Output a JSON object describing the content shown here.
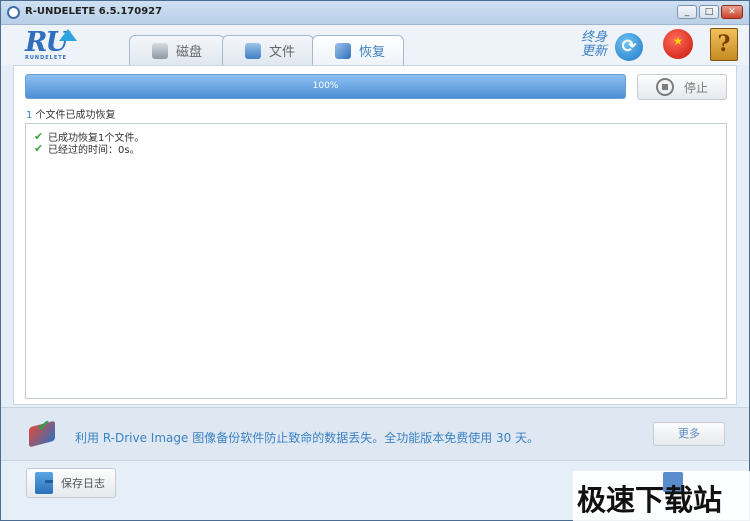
{
  "window": {
    "title": "R-UNDELETE 6.5.170927",
    "controls": [
      "_",
      "□",
      "✕"
    ]
  },
  "logo": {
    "letters": "RU",
    "subtitle": "RUNDELETE"
  },
  "tabs": [
    {
      "label": "磁盘",
      "icon": "disk-icon"
    },
    {
      "label": "文件",
      "icon": "file-icon"
    },
    {
      "label": "恢复",
      "icon": "recovery-icon"
    }
  ],
  "header": {
    "update_text": "终身更新",
    "flag_glyph": "★",
    "help_glyph": "?"
  },
  "progress": {
    "value": 100,
    "label": "100%"
  },
  "stop_button": {
    "label": "停止"
  },
  "summary": {
    "count": "1",
    "text": " 个文件已成功恢复"
  },
  "log": [
    {
      "text": "已成功恢复1个文件。"
    },
    {
      "text": "已经过的时间：0s。"
    }
  ],
  "banner": {
    "text": "利用 R-Drive Image 图像备份软件防止致命的数据丢失。全功能版本免费使用 30 天。",
    "more_label": "更多"
  },
  "footer": {
    "save_log_label": "保存日志"
  },
  "watermark": {
    "text": "极速下载站"
  },
  "colors": {
    "accent": "#3b82c4",
    "progress": "#4d8fd7",
    "check": "#3da33d"
  }
}
